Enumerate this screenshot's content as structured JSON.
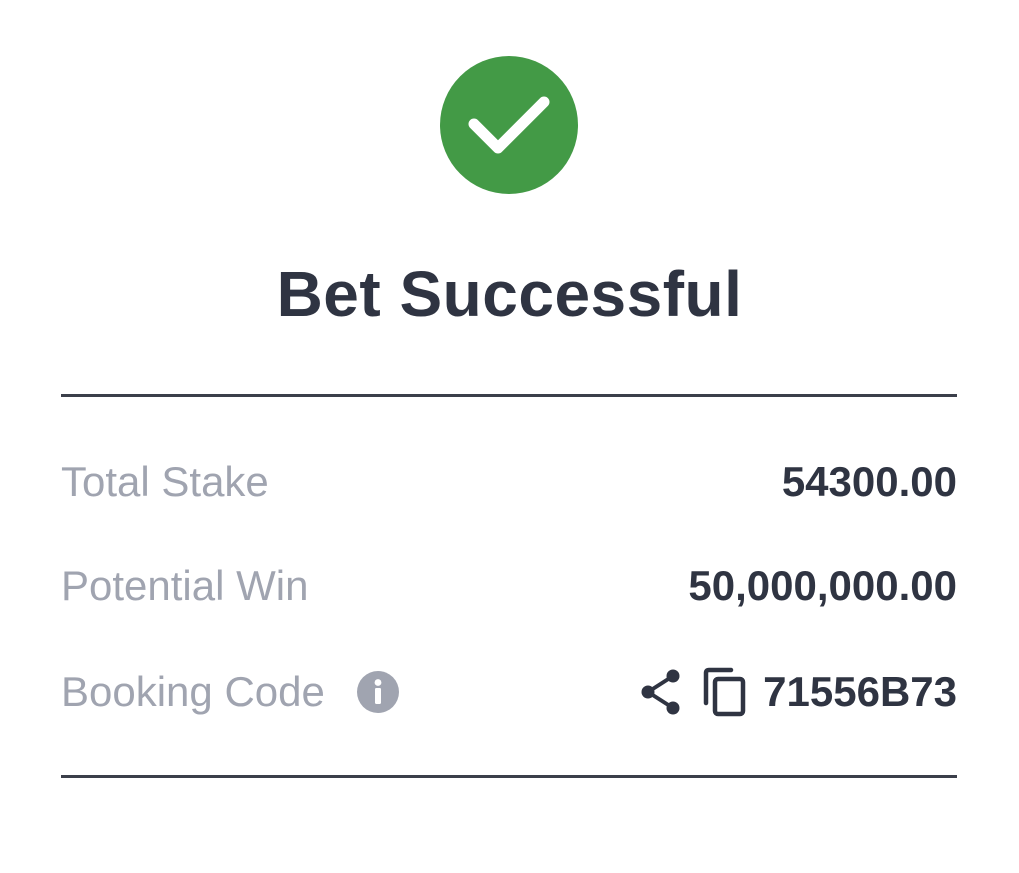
{
  "status": {
    "icon": "check-circle-icon",
    "accent_color": "#439a46",
    "title": "Bet Successful"
  },
  "details": {
    "total_stake": {
      "label": "Total Stake",
      "value": "54300.00"
    },
    "potential_win": {
      "label": "Potential Win",
      "value": "50,000,000.00"
    },
    "booking_code": {
      "label": "Booking Code",
      "info_icon": "info-icon",
      "share_icon": "share-icon",
      "copy_icon": "copy-icon",
      "value": "71556B73"
    }
  },
  "colors": {
    "text_dark": "#2f3442",
    "text_muted": "#a0a4b0",
    "divider": "#3b3f4a"
  }
}
